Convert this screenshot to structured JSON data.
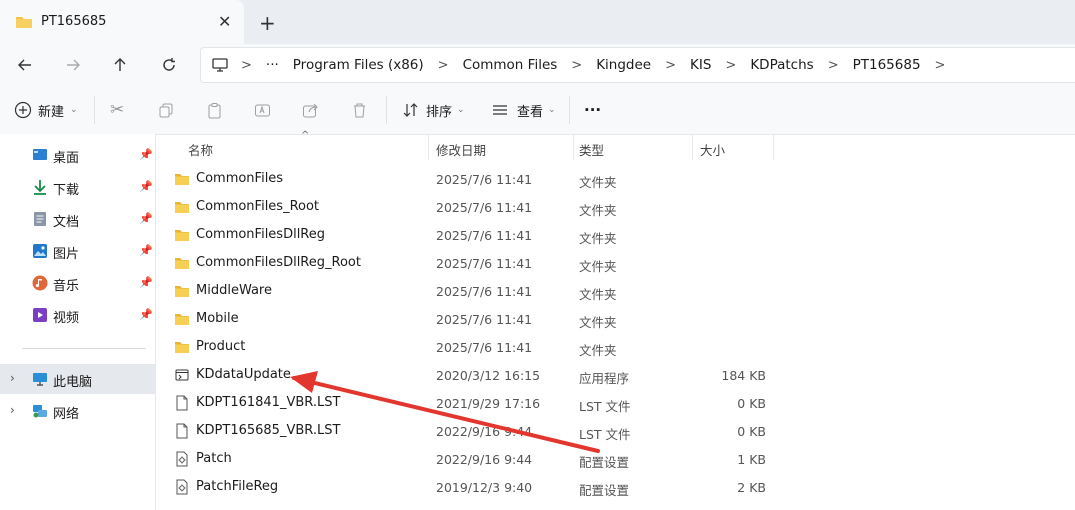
{
  "tab": {
    "title": "PT165685",
    "close": "✕",
    "new": "+"
  },
  "breadcrumb": {
    "more": "···",
    "segments": [
      "Program Files (x86)",
      "Common Files",
      "Kingdee",
      "KIS",
      "KDPatchs",
      "PT165685"
    ],
    "sep": ">"
  },
  "toolbar": {
    "new_label": "新建",
    "sort_label": "排序",
    "view_label": "查看",
    "more": "···"
  },
  "sidebar": {
    "quick": [
      {
        "label": "桌面",
        "icon": "desktop-icon"
      },
      {
        "label": "下载",
        "icon": "download-icon"
      },
      {
        "label": "文档",
        "icon": "document-icon"
      },
      {
        "label": "图片",
        "icon": "picture-icon"
      },
      {
        "label": "音乐",
        "icon": "music-icon"
      },
      {
        "label": "视频",
        "icon": "video-icon"
      }
    ],
    "pc": "此电脑",
    "network": "网络",
    "pin": "📌"
  },
  "columns": {
    "name": "名称",
    "date": "修改日期",
    "type": "类型",
    "size": "大小"
  },
  "files": [
    {
      "name": "CommonFiles",
      "date": "2025/7/6 11:41",
      "type": "文件夹",
      "size": "",
      "kind": "folder"
    },
    {
      "name": "CommonFiles_Root",
      "date": "2025/7/6 11:41",
      "type": "文件夹",
      "size": "",
      "kind": "folder"
    },
    {
      "name": "CommonFilesDllReg",
      "date": "2025/7/6 11:41",
      "type": "文件夹",
      "size": "",
      "kind": "folder"
    },
    {
      "name": "CommonFilesDllReg_Root",
      "date": "2025/7/6 11:41",
      "type": "文件夹",
      "size": "",
      "kind": "folder"
    },
    {
      "name": "MiddleWare",
      "date": "2025/7/6 11:41",
      "type": "文件夹",
      "size": "",
      "kind": "folder"
    },
    {
      "name": "Mobile",
      "date": "2025/7/6 11:41",
      "type": "文件夹",
      "size": "",
      "kind": "folder"
    },
    {
      "name": "Product",
      "date": "2025/7/6 11:41",
      "type": "文件夹",
      "size": "",
      "kind": "folder"
    },
    {
      "name": "KDdataUpdate",
      "date": "2020/3/12 16:15",
      "type": "应用程序",
      "size": "184 KB",
      "kind": "app"
    },
    {
      "name": "KDPT161841_VBR.LST",
      "date": "2021/9/29 17:16",
      "type": "LST 文件",
      "size": "0 KB",
      "kind": "file"
    },
    {
      "name": "KDPT165685_VBR.LST",
      "date": "2022/9/16 9:44",
      "type": "LST 文件",
      "size": "0 KB",
      "kind": "file"
    },
    {
      "name": "Patch",
      "date": "2022/9/16 9:44",
      "type": "配置设置",
      "size": "1 KB",
      "kind": "config"
    },
    {
      "name": "PatchFileReg",
      "date": "2019/12/3 9:40",
      "type": "配置设置",
      "size": "2 KB",
      "kind": "config"
    }
  ],
  "colors": {
    "annotation_arrow": "#e3362f",
    "folder": "#f5c342"
  }
}
